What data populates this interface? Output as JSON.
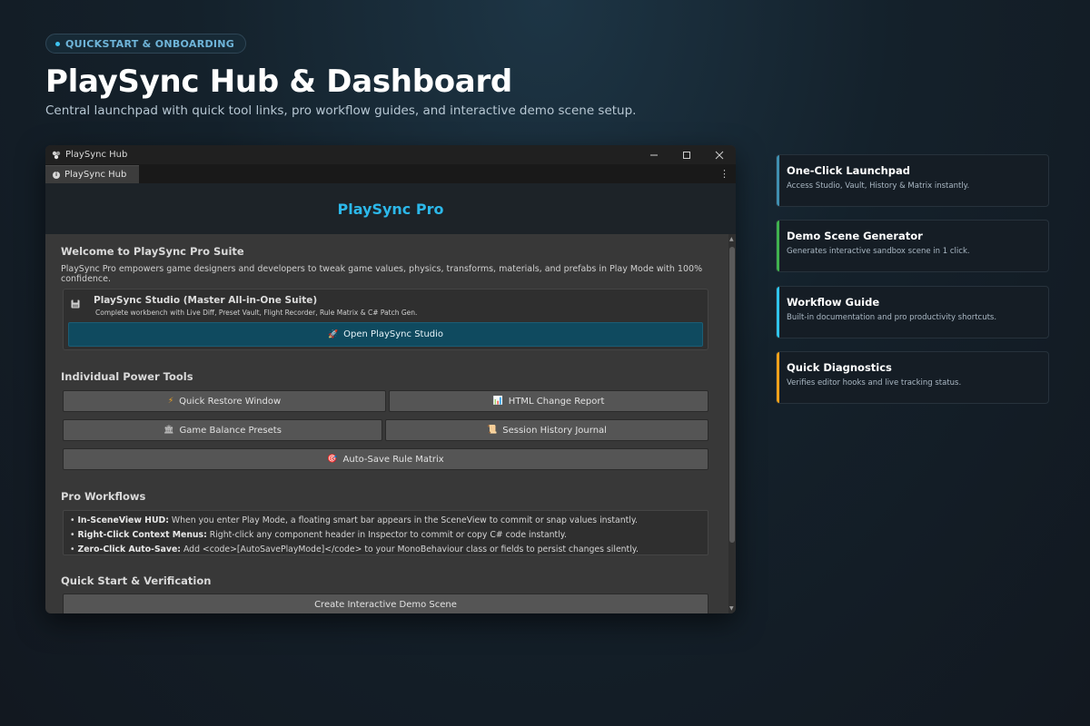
{
  "header": {
    "badge": "QUICKSTART & ONBOARDING",
    "title": "PlaySync Hub & Dashboard",
    "subtitle": "Central launchpad with quick tool links, pro workflow guides, and interactive demo scene setup."
  },
  "window": {
    "title": "PlaySync Hub",
    "tab": "PlaySync Hub",
    "brand": "PlaySync Pro",
    "welcome_title": "Welcome to PlaySync Pro Suite",
    "welcome_desc": "PlaySync Pro empowers game designers and developers to tweak game values, physics, transforms, materials, and prefabs in Play Mode with 100% confidence.",
    "studio": {
      "title": "PlaySync Studio (Master All-in-One Suite)",
      "subtitle": "Complete workbench with Live Diff, Preset Vault, Flight Recorder, Rule Matrix & C# Patch Gen.",
      "button": "Open PlaySync Studio"
    },
    "tools_title": "Individual Power Tools",
    "tools": {
      "quick_restore": "Quick Restore Window",
      "html_report": "HTML Change Report",
      "balance_presets": "Game Balance Presets",
      "session_history": "Session History Journal",
      "rule_matrix": "Auto-Save Rule Matrix"
    },
    "workflows_title": "Pro Workflows",
    "workflows": [
      {
        "label": "In-SceneView HUD:",
        "text": " When you enter Play Mode, a floating smart bar appears in the SceneView to commit or snap values instantly."
      },
      {
        "label": "Right-Click Context Menus:",
        "text": " Right-click any component header in Inspector to commit or copy C# code instantly."
      },
      {
        "label": "Zero-Click Auto-Save:",
        "text": " Add <code>[AutoSavePlayMode]</code> to your MonoBehaviour class or fields to persist changes silently."
      }
    ],
    "quickstart_title": "Quick Start & Verification",
    "demo_button": "Create Interactive Demo Scene"
  },
  "features": [
    {
      "title": "One-Click Launchpad",
      "desc": "Access Studio, Vault, History & Matrix instantly.",
      "color": "#3f8fb0"
    },
    {
      "title": "Demo Scene Generator",
      "desc": "Generates interactive sandbox scene in 1 click.",
      "color": "#3fb24f"
    },
    {
      "title": "Workflow Guide",
      "desc": "Built-in documentation and pro productivity shortcuts.",
      "color": "#2fc4ec"
    },
    {
      "title": "Quick Diagnostics",
      "desc": "Verifies editor hooks and live tracking status.",
      "color": "#f0a11a"
    }
  ]
}
